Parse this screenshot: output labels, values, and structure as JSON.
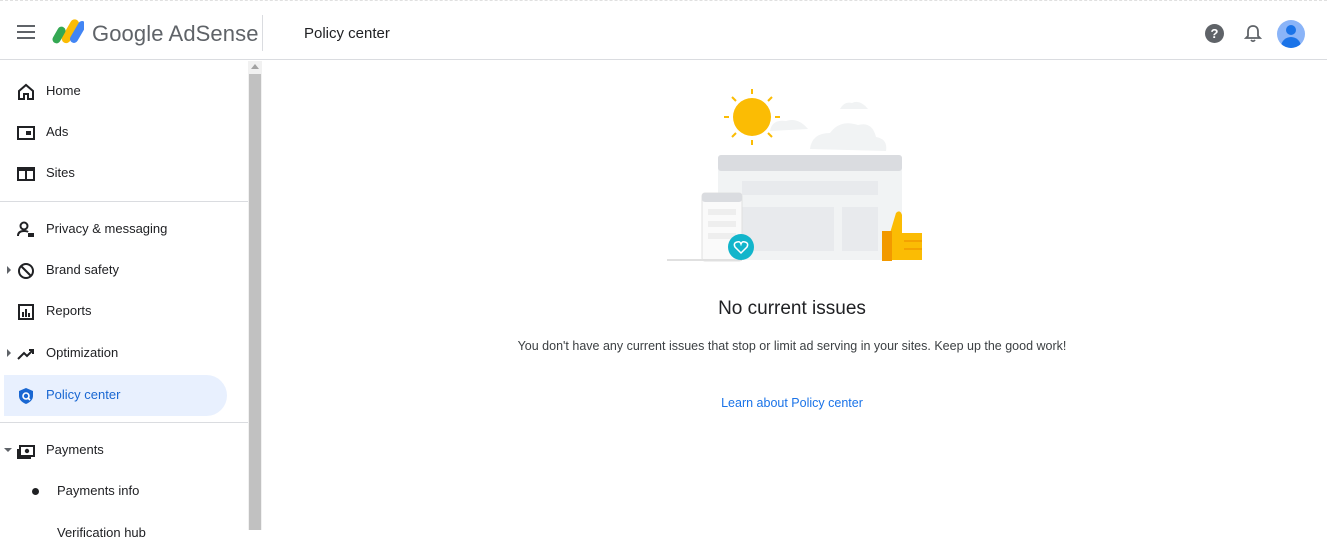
{
  "header": {
    "brand": "Google AdSense",
    "page_title": "Policy center"
  },
  "sidebar": {
    "items": [
      {
        "label": "Home",
        "icon": "home-icon"
      },
      {
        "label": "Ads",
        "icon": "ads-icon"
      },
      {
        "label": "Sites",
        "icon": "sites-icon"
      },
      {
        "label": "Privacy & messaging",
        "icon": "privacy-icon"
      },
      {
        "label": "Brand safety",
        "icon": "block-icon"
      },
      {
        "label": "Reports",
        "icon": "reports-icon"
      },
      {
        "label": "Optimization",
        "icon": "trending-icon"
      },
      {
        "label": "Policy center",
        "icon": "policy-shield-icon",
        "active": true
      },
      {
        "label": "Payments",
        "icon": "payments-icon"
      }
    ],
    "sub_items": [
      {
        "label": "Payments info"
      },
      {
        "label": "Verification hub"
      }
    ]
  },
  "main": {
    "title": "No current issues",
    "description": "You don't have any current issues that stop or limit ad serving in your sites. Keep up the good work!",
    "link": "Learn about Policy center"
  },
  "colors": {
    "accent": "#1a73e8",
    "active_bg": "#e8f0fe",
    "sun": "#fbbc04",
    "teal": "#12b5cb"
  }
}
